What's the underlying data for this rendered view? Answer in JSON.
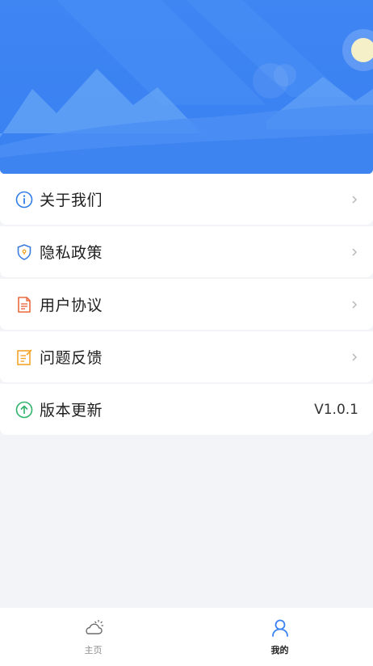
{
  "banner": {
    "background_color": "#3b82f2",
    "sun_color": "#f5f0c8"
  },
  "menu": {
    "items": [
      {
        "label": "关于我们",
        "icon": "info-icon",
        "icon_color": "#2f7de6"
      },
      {
        "label": "隐私政策",
        "icon": "shield-icon",
        "icon_color": "#3a7be0"
      },
      {
        "label": "用户协议",
        "icon": "document-icon",
        "icon_color": "#ec6a3f"
      },
      {
        "label": "问题反馈",
        "icon": "feedback-icon",
        "icon_color": "#f4a428"
      },
      {
        "label": "版本更新",
        "icon": "upgrade-icon",
        "icon_color": "#2fb36b",
        "value": "V1.0.1"
      }
    ]
  },
  "tabbar": {
    "tabs": [
      {
        "label": "主页",
        "icon": "weather-cloud-sun-icon",
        "active": false
      },
      {
        "label": "我的",
        "icon": "user-icon",
        "active": true
      }
    ],
    "active_color": "#3b82f2",
    "inactive_color": "#8a8a8a"
  }
}
